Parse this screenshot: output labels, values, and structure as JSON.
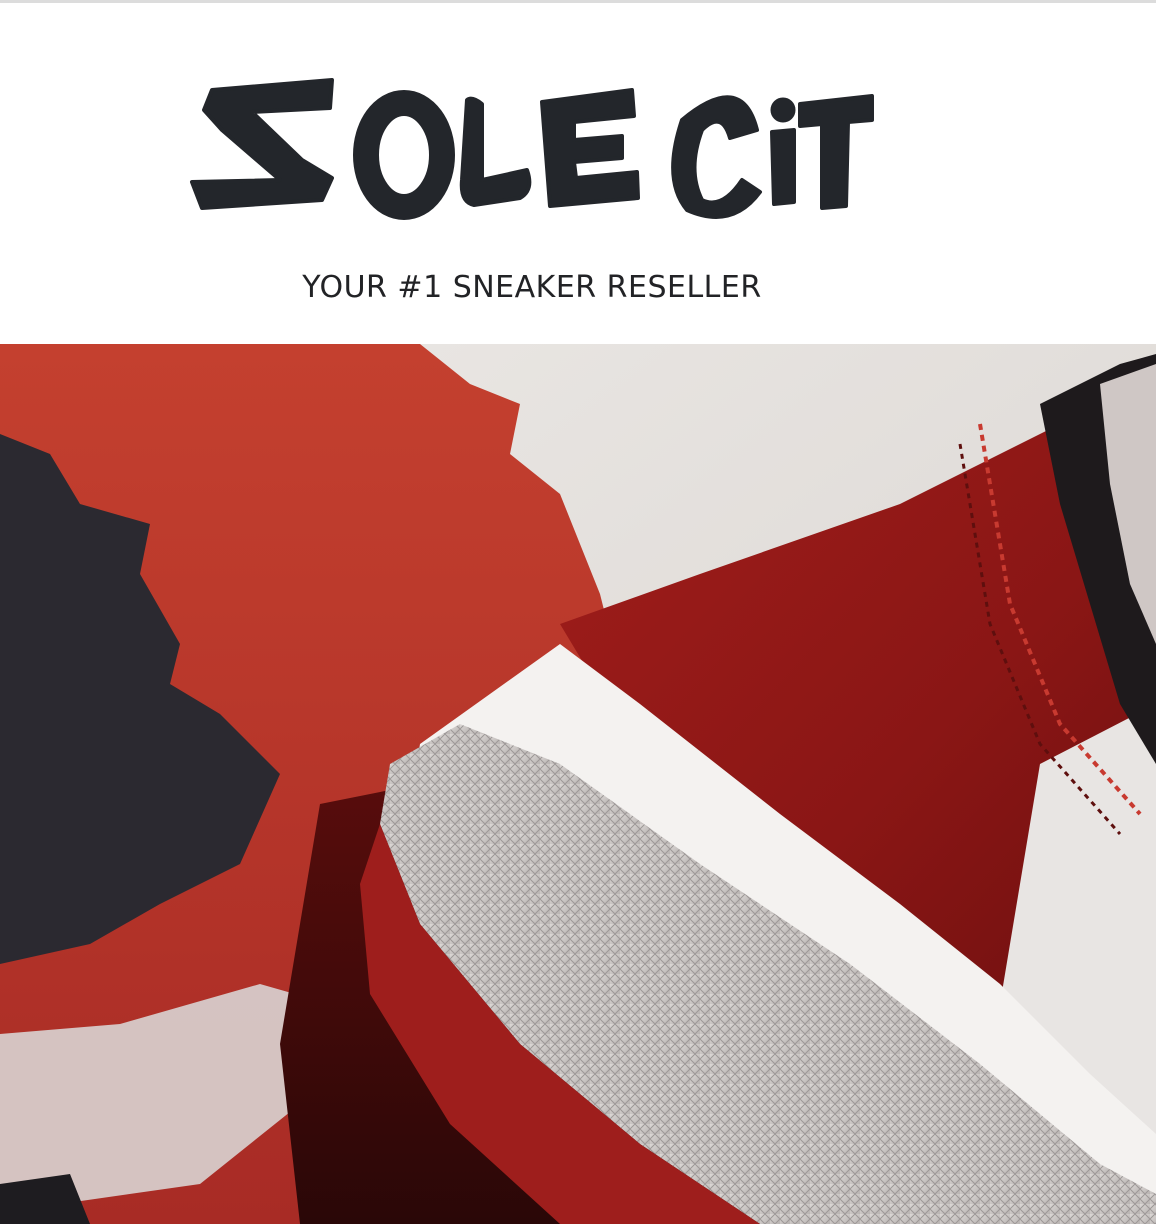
{
  "brand": {
    "name": "SOLE CITY",
    "tagline": "YOUR #1 SNEAKER RESELLER"
  },
  "hero": {
    "image_name": "sneaker-closeup"
  },
  "colors": {
    "logo_ink": "#23262b",
    "background": "#ffffff",
    "hero_red": "#b9352c",
    "leather_red": "#8f1716",
    "off_white": "#e6e4e1",
    "shadow_black": "#26252a"
  }
}
